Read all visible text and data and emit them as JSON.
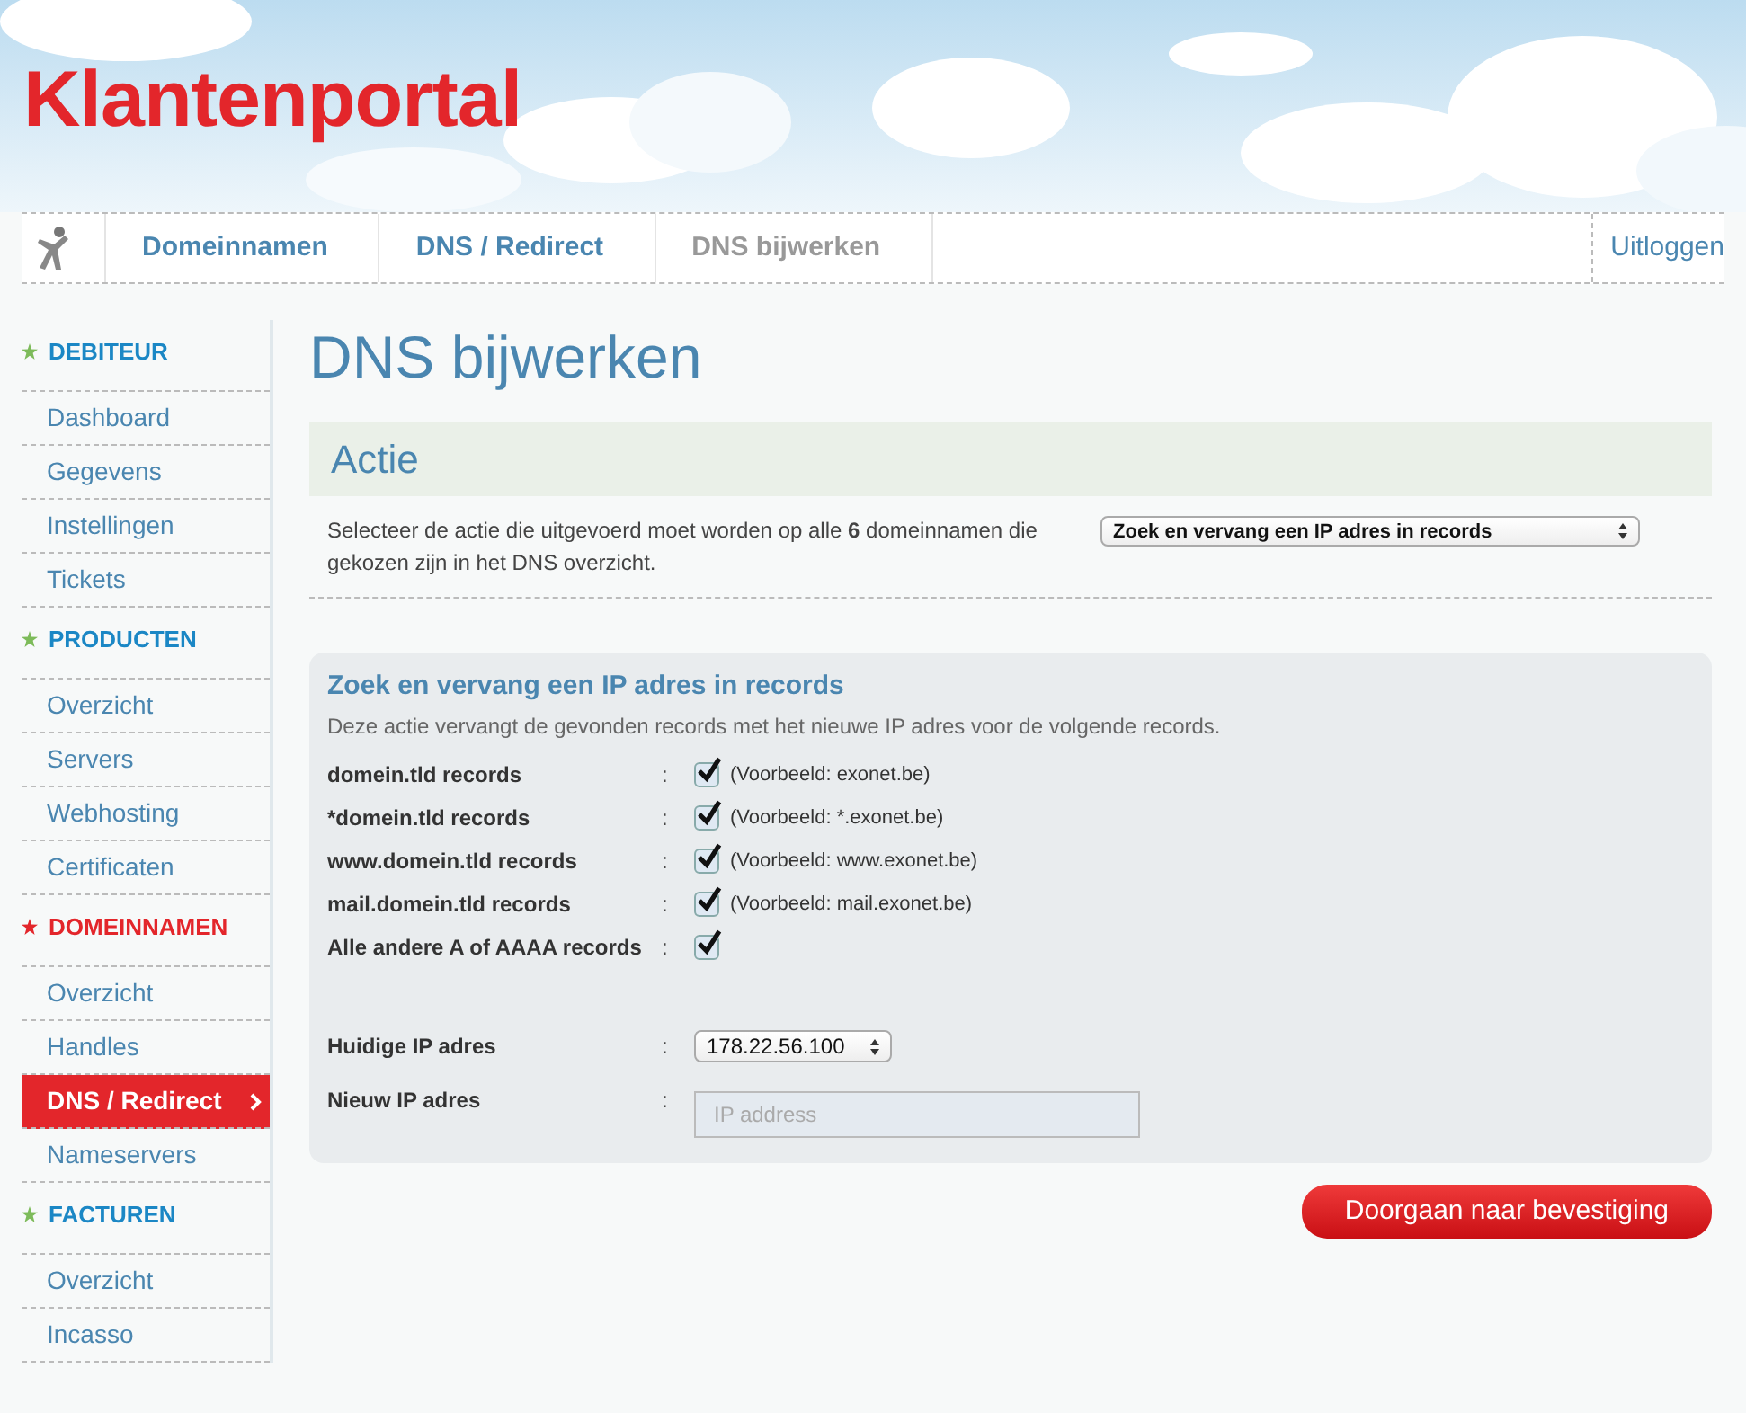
{
  "header": {
    "title": "Klantenportal"
  },
  "breadcrumb": {
    "items": [
      {
        "label": "Domeinnamen",
        "current": false
      },
      {
        "label": "DNS / Redirect",
        "current": false
      },
      {
        "label": "DNS bijwerken",
        "current": true
      }
    ],
    "logout": "Uitloggen"
  },
  "sidebar": {
    "sections": [
      {
        "title": "DEBITEUR",
        "selected": false,
        "color": "#7dbb5a",
        "items": [
          {
            "label": "Dashboard",
            "selected": false
          },
          {
            "label": "Gegevens",
            "selected": false
          },
          {
            "label": "Instellingen",
            "selected": false
          },
          {
            "label": "Tickets",
            "selected": false
          }
        ]
      },
      {
        "title": "PRODUCTEN",
        "selected": false,
        "color": "#7dbb5a",
        "items": [
          {
            "label": "Overzicht",
            "selected": false
          },
          {
            "label": "Servers",
            "selected": false
          },
          {
            "label": "Webhosting",
            "selected": false
          },
          {
            "label": "Certificaten",
            "selected": false
          }
        ]
      },
      {
        "title": "DOMEINNAMEN",
        "selected": true,
        "color": "#e3262b",
        "items": [
          {
            "label": "Overzicht",
            "selected": false
          },
          {
            "label": "Handles",
            "selected": false
          },
          {
            "label": "DNS / Redirect",
            "selected": true
          },
          {
            "label": "Nameservers",
            "selected": false
          }
        ]
      },
      {
        "title": "FACTUREN",
        "selected": false,
        "color": "#7dbb5a",
        "items": [
          {
            "label": "Overzicht",
            "selected": false
          },
          {
            "label": "Incasso",
            "selected": false
          }
        ]
      }
    ]
  },
  "page_title": "DNS bijwerken",
  "action": {
    "heading": "Actie",
    "text": "Selecteer de actie die uitgevoerd moet worden op alle **6** domeinnamen die gekozen zijn in het DNS overzicht.",
    "select_value": "Zoek en vervang een IP adres in records"
  },
  "panel": {
    "heading": "Zoek en vervang een IP adres in records",
    "description": "Deze actie vervangt de gevonden records met het nieuwe IP adres voor de volgende records.",
    "records": [
      {
        "label": "domein.tld records",
        "colon": ":",
        "checked": true,
        "example": "(Voorbeeld: exonet.be)"
      },
      {
        "label": "*domein.tld records",
        "colon": ":",
        "checked": true,
        "example": "(Voorbeeld: *.exonet.be)"
      },
      {
        "label": "www.domein.tld records",
        "colon": ":",
        "checked": true,
        "example": "(Voorbeeld: www.exonet.be)"
      },
      {
        "label": "mail.domein.tld records",
        "colon": ":",
        "checked": true,
        "example": "(Voorbeeld: mail.exonet.be)"
      },
      {
        "label": "Alle andere A of AAAA records",
        "colon": ":",
        "checked": true
      }
    ],
    "fields": [
      {
        "kind": "select",
        "label": "Huidige IP adres",
        "colon": ":",
        "value": "178.22.56.100"
      },
      {
        "kind": "input",
        "label": "Nieuw IP adres",
        "colon": ":",
        "placeholder": "IP address"
      }
    ]
  },
  "submit": "Doorgaan naar bevestiging"
}
